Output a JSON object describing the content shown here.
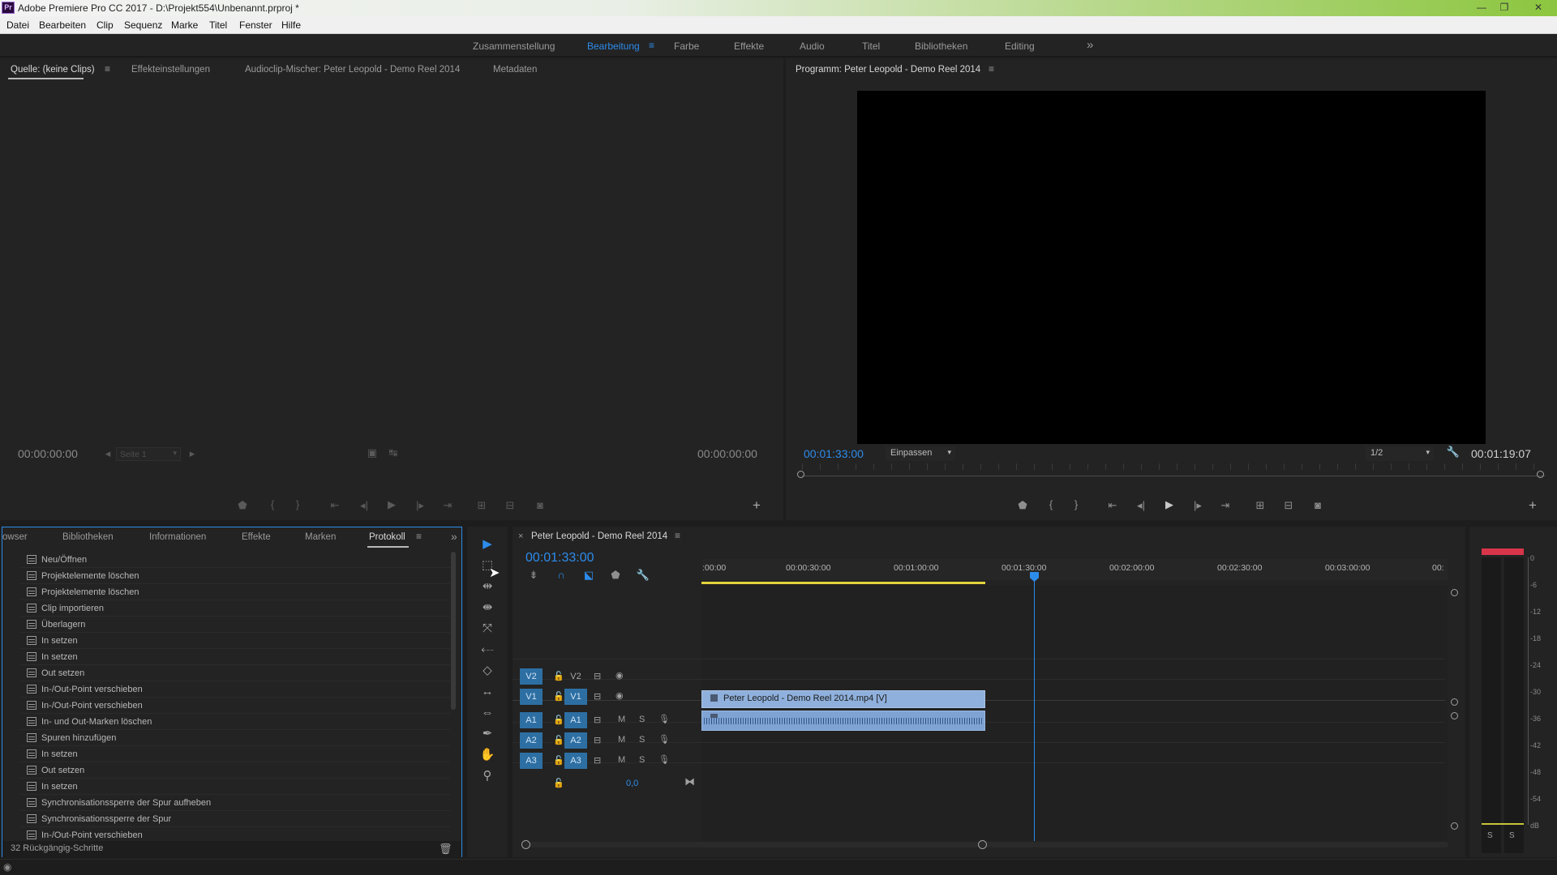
{
  "window": {
    "title": "Adobe Premiere Pro CC 2017 - D:\\Projekt554\\Unbenannt.prproj *",
    "app_icon_text": "Pr",
    "controls": [
      "—",
      "❐",
      "✕"
    ]
  },
  "menu": [
    "Datei",
    "Bearbeiten",
    "Clip",
    "Sequenz",
    "Marke",
    "Titel",
    "Fenster",
    "Hilfe"
  ],
  "workspaces": {
    "items": [
      "Zusammenstellung",
      "Bearbeitung",
      "Farbe",
      "Effekte",
      "Audio",
      "Titel",
      "Bibliotheken",
      "Editing"
    ],
    "active": "Bearbeitung",
    "overflow": "»"
  },
  "source_panel": {
    "tabs": [
      "Quelle: (keine Clips)",
      "Effekteinstellungen",
      "Audioclip-Mischer: Peter Leopold - Demo Reel 2014",
      "Metadaten"
    ],
    "timecode_left": "00:00:00:00",
    "page_select": "Seite 1",
    "timecode_right": "00:00:00:00",
    "add": "+"
  },
  "program_panel": {
    "tab": "Programm: Peter Leopold - Demo Reel 2014",
    "timecode": "00:01:33:00",
    "fit": "Einpassen",
    "resolution": "1/2",
    "duration": "00:01:19:07",
    "add": "+"
  },
  "history_panel": {
    "tabs": [
      "owser",
      "Bibliotheken",
      "Informationen",
      "Effekte",
      "Marken",
      "Protokoll"
    ],
    "active_tab": "Protokoll",
    "items": [
      "Neu/Öffnen",
      "Projektelemente löschen",
      "Projektelemente löschen",
      "Clip importieren",
      "Überlagern",
      "In setzen",
      "In setzen",
      "Out setzen",
      "In-/Out-Point verschieben",
      "In-/Out-Point verschieben",
      "In- und Out-Marken löschen",
      "Spuren hinzufügen",
      "In setzen",
      "Out setzen",
      "In setzen",
      "Synchronisationssperre der Spur aufheben",
      "Synchronisationssperre der Spur",
      "In-/Out-Point verschieben"
    ],
    "footer": "32 Rückgängig-Schritte"
  },
  "timeline": {
    "tab": "Peter Leopold - Demo Reel 2014",
    "timecode": "00:01:33:00",
    "ruler": [
      ":00:00",
      "00:00:30:00",
      "00:01:00:00",
      "00:01:30:00",
      "00:02:00:00",
      "00:02:30:00",
      "00:03:00:00",
      "00:"
    ],
    "video_tracks": [
      {
        "src": "V2",
        "name": "V2"
      },
      {
        "src": "V1",
        "name": "V1"
      }
    ],
    "audio_tracks": [
      {
        "src": "A1",
        "name": "A1",
        "m": "M",
        "s": "S"
      },
      {
        "src": "A2",
        "name": "A2",
        "m": "M",
        "s": "S"
      },
      {
        "src": "A3",
        "name": "A3",
        "m": "M",
        "s": "S"
      }
    ],
    "master_value": "0,0",
    "clip_label": "Peter Leopold - Demo Reel 2014.mp4 [V]"
  },
  "audio_meter": {
    "scale": [
      "0",
      "-6",
      "-12",
      "-18",
      "-24",
      "-30",
      "-36",
      "-42",
      "-48",
      "-54",
      "dB"
    ],
    "solo": [
      "S",
      "S"
    ]
  },
  "colors": {
    "accent": "#2d8ceb",
    "clip_video": "#8fb0dc",
    "clip_audio": "#7fa3d3",
    "track_button": "#2d6fa3",
    "work_area": "#e3d43c",
    "meter_peak": "#d9354a"
  }
}
